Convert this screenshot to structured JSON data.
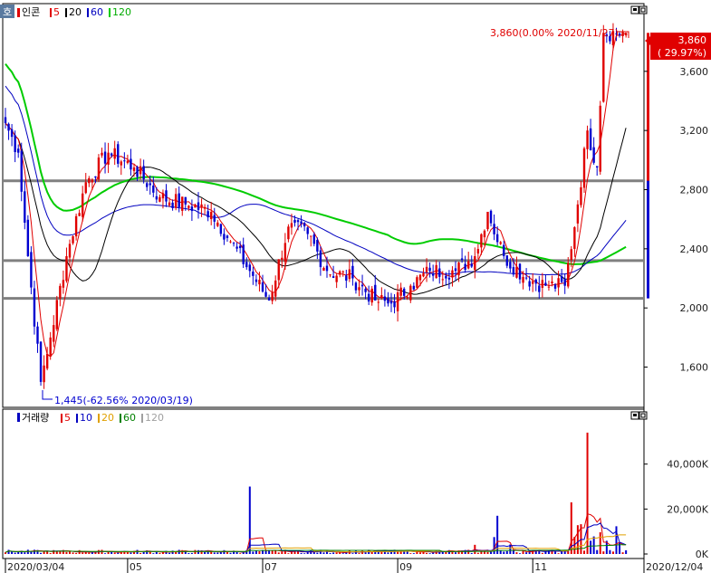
{
  "price_panel": {
    "stock_name": "인콘",
    "badge": "호",
    "ma_legend": [
      {
        "label": "5",
        "color": "#e00000"
      },
      {
        "label": "20",
        "color": "#000000"
      },
      {
        "label": "60",
        "color": "#0000c0"
      },
      {
        "label": "120",
        "color": "#00cc00"
      }
    ],
    "current_price_label": "3,860",
    "current_change_label": "( 29.97%)",
    "high_annotation": "3,860(0.00% 2020/11/27)",
    "low_annotation": "1,445(-62.56% 2020/03/19)"
  },
  "volume_panel": {
    "title": "거래량",
    "ma_legend": [
      {
        "label": "5",
        "color": "#e00000"
      },
      {
        "label": "10",
        "color": "#0000c0"
      },
      {
        "label": "20",
        "color": "#e0a000"
      },
      {
        "label": "60",
        "color": "#008000"
      },
      {
        "label": "120",
        "color": "#a0a0a0"
      }
    ]
  },
  "colors": {
    "up": "#e00000",
    "down": "#0000d0",
    "ma5": "#e00000",
    "ma20": "#000000",
    "ma60": "#0000c0",
    "ma120": "#00cc00",
    "support_line": "#808080"
  },
  "chart_data": [
    {
      "type": "candlestick",
      "title": "인콘",
      "y_ticks": [
        1600,
        2000,
        2400,
        2800,
        3200,
        3600
      ],
      "y_tick_labels": [
        "1,600",
        "2,000",
        "2,400",
        "2,800",
        "3,200",
        "3,600"
      ],
      "ylim": [
        1340,
        3960
      ],
      "x_tick_labels": [
        {
          "label": "2020/03/04",
          "index": 0
        },
        {
          "label": "05",
          "index": 38
        },
        {
          "label": "07",
          "index": 80
        },
        {
          "label": "09",
          "index": 122
        },
        {
          "label": "11",
          "index": 164
        },
        {
          "label": "2020/12/04",
          "index": 196
        }
      ],
      "horizontal_lines": [
        2860,
        2320,
        2065
      ],
      "key_points": [
        {
          "label": "max",
          "index": 181,
          "value": 3860
        },
        {
          "label": "min",
          "index": 11,
          "value": 1445
        },
        {
          "label": "last",
          "index": 193,
          "value": 3860
        }
      ],
      "series_approx_close": [
        {
          "x": 0,
          "y": 3250
        },
        {
          "x": 4,
          "y": 3050
        },
        {
          "x": 7,
          "y": 2350
        },
        {
          "x": 11,
          "y": 1500
        },
        {
          "x": 14,
          "y": 1800
        },
        {
          "x": 19,
          "y": 2350
        },
        {
          "x": 25,
          "y": 2850
        },
        {
          "x": 32,
          "y": 3050
        },
        {
          "x": 40,
          "y": 2950
        },
        {
          "x": 48,
          "y": 2750
        },
        {
          "x": 56,
          "y": 2700
        },
        {
          "x": 64,
          "y": 2650
        },
        {
          "x": 70,
          "y": 2450
        },
        {
          "x": 76,
          "y": 2250
        },
        {
          "x": 82,
          "y": 2050
        },
        {
          "x": 88,
          "y": 2550
        },
        {
          "x": 94,
          "y": 2500
        },
        {
          "x": 100,
          "y": 2250
        },
        {
          "x": 108,
          "y": 2200
        },
        {
          "x": 115,
          "y": 2050
        },
        {
          "x": 120,
          "y": 2030
        },
        {
          "x": 126,
          "y": 2150
        },
        {
          "x": 132,
          "y": 2250
        },
        {
          "x": 140,
          "y": 2250
        },
        {
          "x": 146,
          "y": 2350
        },
        {
          "x": 150,
          "y": 2650
        },
        {
          "x": 155,
          "y": 2350
        },
        {
          "x": 162,
          "y": 2200
        },
        {
          "x": 168,
          "y": 2150
        },
        {
          "x": 174,
          "y": 2150
        },
        {
          "x": 178,
          "y": 2700
        },
        {
          "x": 181,
          "y": 3200
        },
        {
          "x": 184,
          "y": 2950
        },
        {
          "x": 186,
          "y": 3860
        },
        {
          "x": 193,
          "y": 3860
        }
      ]
    },
    {
      "type": "bar",
      "title": "거래량",
      "y_ticks": [
        0,
        20000,
        40000
      ],
      "y_tick_labels": [
        "0K",
        "20,000K",
        "40,000K"
      ],
      "ylim": [
        0,
        58000
      ],
      "spikes": [
        {
          "index": 76,
          "value": 30000
        },
        {
          "index": 153,
          "value": 17000
        },
        {
          "index": 176,
          "value": 23000
        },
        {
          "index": 181,
          "value": 54000
        }
      ]
    }
  ]
}
